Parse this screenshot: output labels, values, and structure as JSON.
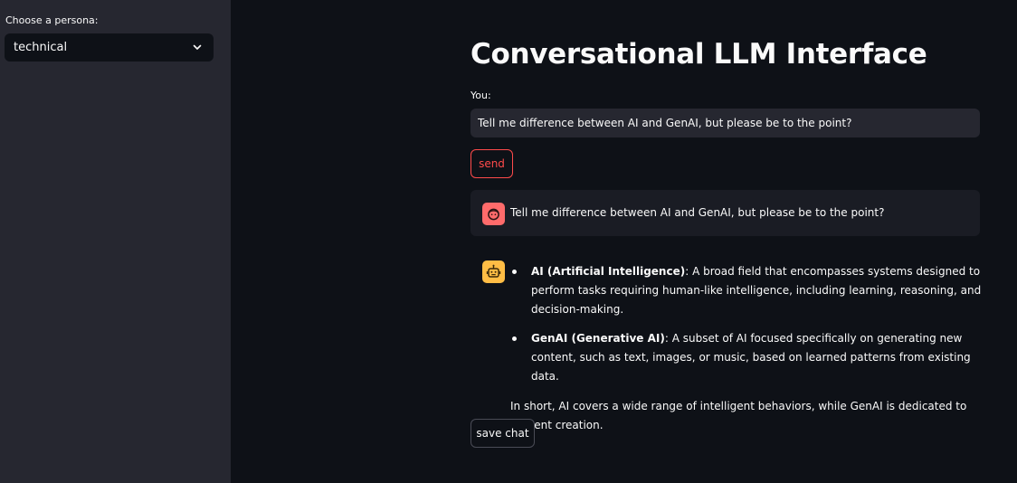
{
  "sidebar": {
    "persona_label": "Choose a persona:",
    "persona_value": "technical"
  },
  "main": {
    "title": "Conversational LLM Interface",
    "input_label": "You:",
    "input_value": "Tell me difference between AI and GenAI, but please be to the point?",
    "send_label": "send",
    "save_label": "save chat"
  },
  "chat": {
    "user_message": "Tell me difference between AI and GenAI, but please be to the point?",
    "assistant": {
      "bullets": [
        {
          "term": "AI (Artificial Intelligence)",
          "text": ": A broad field that encompasses systems designed to perform tasks requiring human-like intelligence, including learning, reasoning, and decision-making."
        },
        {
          "term": "GenAI (Generative AI)",
          "text": ": A subset of AI focused specifically on generating new content, such as text, images, or music, based on learned patterns from existing data."
        }
      ],
      "summary": "In short, AI covers a wide range of intelligent behaviors, while GenAI is dedicated to content creation."
    }
  },
  "icons": {
    "persona_chevron": "chevron-down-icon",
    "user_avatar": "user-face-icon",
    "assistant_avatar": "robot-icon"
  },
  "colors": {
    "background": "#0e1117",
    "sidebar": "#262730",
    "accent": "#ff4b4b",
    "user_avatar": "#ff6b6b",
    "assistant_avatar": "#ffbd45"
  }
}
